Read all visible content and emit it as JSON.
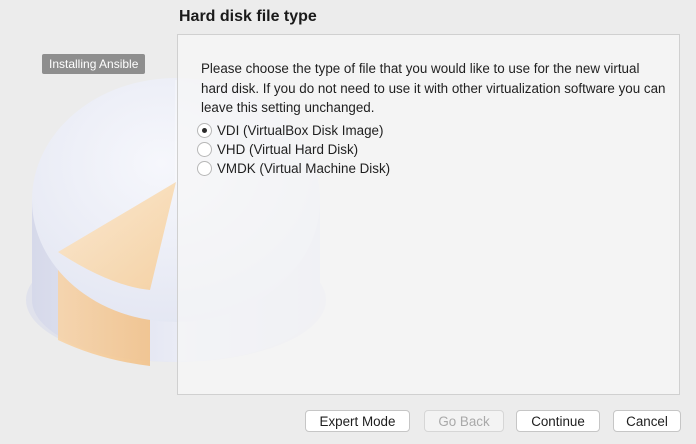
{
  "badge": {
    "vm_name": "Installing Ansible"
  },
  "page": {
    "title": "Hard disk file type",
    "description": "Please choose the type of file that you would like to use for the new virtual hard disk. If you do not need to use it with other virtualization software you can leave this setting unchanged."
  },
  "options": [
    {
      "label": "VDI (VirtualBox Disk Image)",
      "selected": true
    },
    {
      "label": "VHD (Virtual Hard Disk)",
      "selected": false
    },
    {
      "label": "VMDK (Virtual Machine Disk)",
      "selected": false
    }
  ],
  "buttons": {
    "expert_mode": "Expert Mode",
    "go_back": "Go Back",
    "continue": "Continue",
    "cancel": "Cancel"
  },
  "colors": {
    "window_bg": "#ececec",
    "disk_top": "#eef0f8",
    "disk_slice": "#f7d2a2",
    "badge_bg": "#8e8e8e"
  },
  "icons": {
    "disk_illustration": "hard-disk-pie-illustration"
  }
}
